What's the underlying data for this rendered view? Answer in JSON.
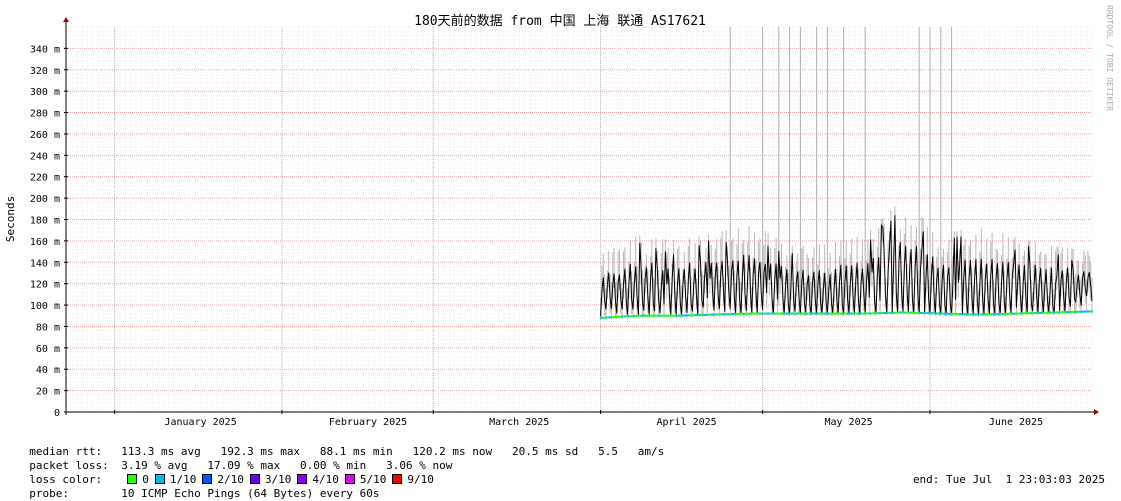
{
  "chart_data": {
    "type": "line",
    "title": "180天前的数据 from 中国 上海 联通 AS17621",
    "ylabel": "Seconds",
    "xlabel": "",
    "watermark": "RRDTOOL / TOBI OETIKER",
    "ylim": [
      0,
      360
    ],
    "y_ticks": [
      {
        "value": 0,
        "label": "0"
      },
      {
        "value": 20,
        "label": "20 m"
      },
      {
        "value": 40,
        "label": "40 m"
      },
      {
        "value": 60,
        "label": "60 m"
      },
      {
        "value": 80,
        "label": "80 m"
      },
      {
        "value": 100,
        "label": "100 m"
      },
      {
        "value": 120,
        "label": "120 m"
      },
      {
        "value": 140,
        "label": "140 m"
      },
      {
        "value": 160,
        "label": "160 m"
      },
      {
        "value": 180,
        "label": "180 m"
      },
      {
        "value": 200,
        "label": "200 m"
      },
      {
        "value": 220,
        "label": "220 m"
      },
      {
        "value": 240,
        "label": "240 m"
      },
      {
        "value": 260,
        "label": "260 m"
      },
      {
        "value": 280,
        "label": "280 m"
      },
      {
        "value": 300,
        "label": "300 m"
      },
      {
        "value": 320,
        "label": "320 m"
      },
      {
        "value": 340,
        "label": "340 m"
      }
    ],
    "xlim": [
      "2024-12-23",
      "2025-07-01"
    ],
    "x_ticks": [
      {
        "date": "2025-01-01",
        "label": "January 2025"
      },
      {
        "date": "2025-02-01",
        "label": "February 2025"
      },
      {
        "date": "2025-03-01",
        "label": "March 2025"
      },
      {
        "date": "2025-04-01",
        "label": "April 2025"
      },
      {
        "date": "2025-05-01",
        "label": "May 2025"
      },
      {
        "date": "2025-06-01",
        "label": "June 2025"
      }
    ],
    "grid": true,
    "series": [
      {
        "name": "median rtt",
        "color": "#000000",
        "x": [
          "2025-04-01",
          "2025-04-08",
          "2025-04-15",
          "2025-04-22",
          "2025-04-29",
          "2025-05-06",
          "2025-05-13",
          "2025-05-20",
          "2025-05-27",
          "2025-06-03",
          "2025-06-10",
          "2025-06-17",
          "2025-06-24",
          "2025-07-01"
        ],
        "values": [
          110,
          115,
          112,
          118,
          120,
          112,
          110,
          115,
          125,
          112,
          115,
          116,
          110,
          120
        ],
        "peaks": [
          142,
          160,
          155,
          162,
          172,
          150,
          152,
          160,
          195,
          160,
          170,
          158,
          150,
          145
        ],
        "lows": [
          88,
          90,
          90,
          91,
          92,
          92,
          92,
          92,
          93,
          92,
          91,
          92,
          93,
          94
        ]
      },
      {
        "name": "packet loss spikes",
        "color": "#b0b0b0",
        "x": [
          "2025-04-25",
          "2025-05-01",
          "2025-05-04",
          "2025-05-06",
          "2025-05-08",
          "2025-05-11",
          "2025-05-13",
          "2025-05-16",
          "2025-05-20",
          "2025-05-30",
          "2025-06-01",
          "2025-06-03",
          "2025-06-05"
        ],
        "values": [
          360,
          360,
          360,
          360,
          360,
          360,
          360,
          360,
          360,
          360,
          360,
          360,
          360
        ]
      }
    ]
  },
  "legend": {
    "median_rtt_key": "median rtt:",
    "median_rtt_values": "113.3 ms avg   192.3 ms max   88.1 ms min   120.2 ms now   20.5 ms sd   5.5   am/s",
    "packet_loss_key": "packet loss:",
    "packet_loss_values": "3.19 % avg   17.09 % max   0.00 % min   3.06 % now",
    "loss_color_key": "loss color:",
    "loss_colors": [
      {
        "label": "0",
        "color": "#26ff00"
      },
      {
        "label": "1/10",
        "color": "#00b8ff"
      },
      {
        "label": "2/10",
        "color": "#0059ff"
      },
      {
        "label": "3/10",
        "color": "#5e00ff"
      },
      {
        "label": "4/10",
        "color": "#7e00ff"
      },
      {
        "label": "5/10",
        "color": "#dd00ff"
      },
      {
        "label": "9/10",
        "color": "#ff0000"
      }
    ],
    "probe_key": "probe:",
    "probe_values": "10 ICMP Echo Pings (64 Bytes) every 60s",
    "end_text": "end: Tue Jul  1 23:03:03 2025"
  }
}
